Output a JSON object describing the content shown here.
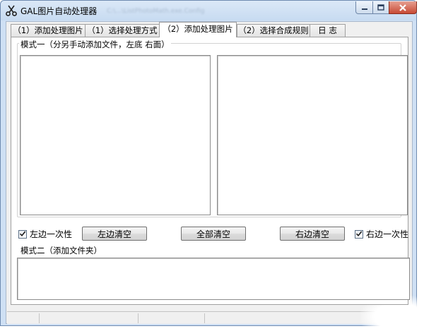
{
  "window": {
    "title": "GAL图片自动处理器",
    "blurred_text": "C:\\...\\ListPhotoMath.exe.Config"
  },
  "icons": {
    "app": "scissors-icon",
    "minimize": "minimize-icon",
    "maximize": "maximize-icon",
    "close": "close-icon"
  },
  "tabs": [
    {
      "label": "（1）添加处理图片",
      "active": false
    },
    {
      "label": "（1）选择处理方式",
      "active": false
    },
    {
      "label": "（2）添加处理图片",
      "active": true
    },
    {
      "label": "（2）选择合成规则",
      "active": false
    },
    {
      "label": "日 志",
      "active": false
    }
  ],
  "mode1": {
    "label": "模式一（分另手动添加文件，左底 右面）"
  },
  "controls": {
    "left_once": {
      "label": "左边一次性",
      "checked": true
    },
    "right_once": {
      "label": "右边一次性",
      "checked": true
    },
    "clear_left": "左边清空",
    "clear_all": "全部清空",
    "clear_right": "右边清空"
  },
  "mode2": {
    "label": "模式二（添加文件夹）"
  },
  "colors": {
    "titlebar": "#cfe0f4",
    "close_button": "#c74a35",
    "face": "#f0f0f0"
  }
}
